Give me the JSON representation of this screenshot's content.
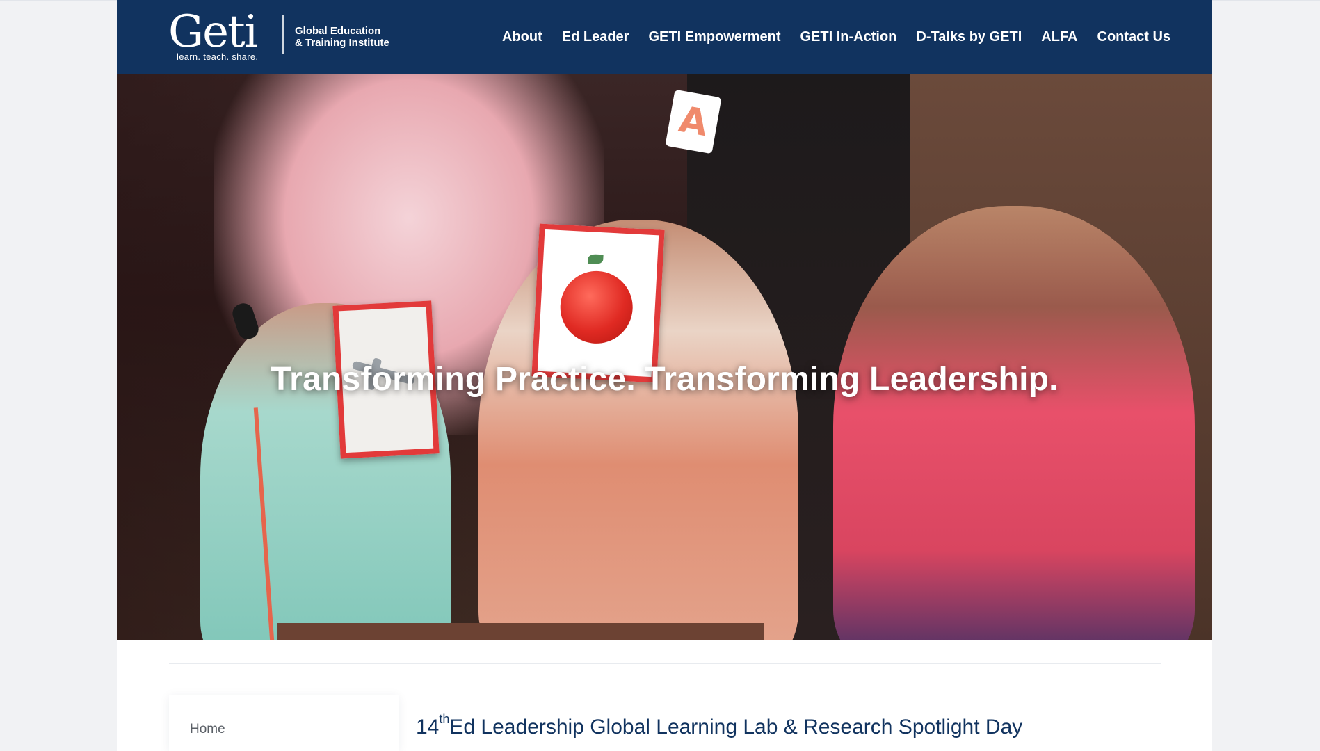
{
  "header": {
    "logo": {
      "wordmark": "Geti",
      "tagline": "learn. teach. share.",
      "name_line1": "Global Education",
      "name_line2": "& Training Institute"
    },
    "nav": [
      {
        "label": "About"
      },
      {
        "label": "Ed Leader"
      },
      {
        "label": "GETI Empowerment"
      },
      {
        "label": "GETI In-Action"
      },
      {
        "label": "D-Talks by GETI"
      },
      {
        "label": "ALFA"
      },
      {
        "label": "Contact Us"
      }
    ]
  },
  "hero": {
    "headline": "Transforming Practice. Transforming Leadership.",
    "card_letter": "A"
  },
  "sidebar": {
    "home_label": "Home"
  },
  "post": {
    "title_number": "14",
    "title_ordinal": "th",
    "title_rest": "Ed Leadership Global Learning Lab & Research Spotlight Day"
  },
  "colors": {
    "header_bg": "#11335f",
    "title_color": "#11335f",
    "page_bg": "#f1f2f4"
  }
}
